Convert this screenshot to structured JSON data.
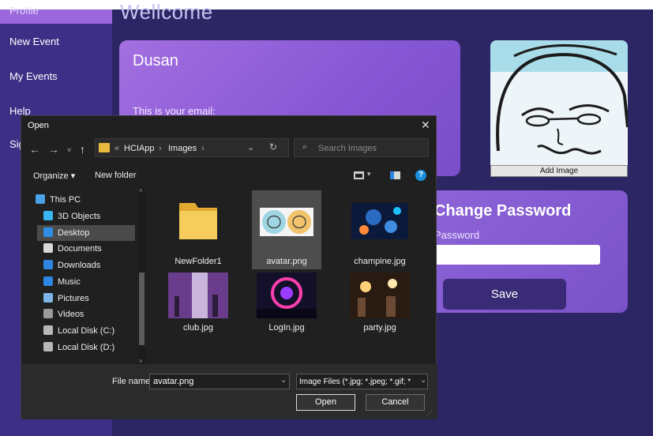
{
  "sidebar": {
    "items": [
      {
        "label": "Profile"
      },
      {
        "label": "New Event"
      },
      {
        "label": "My Events"
      },
      {
        "label": "Help"
      },
      {
        "label": "Sign Out"
      }
    ]
  },
  "main": {
    "welcome": "Wellcome",
    "user_card": {
      "name": "Dusan",
      "email_label": "This is your email:"
    },
    "avatar": {
      "add_image_label": "Add Image"
    },
    "password_card": {
      "title": "Change Password",
      "field_label": "Password",
      "save_label": "Save"
    }
  },
  "dialog": {
    "title": "Open",
    "breadcrumb": [
      "«",
      "HCIApp",
      "›",
      "Images",
      "›"
    ],
    "search_placeholder": "Search Images",
    "toolbar": {
      "organize": "Organize ▾",
      "new_folder": "New folder",
      "help": "?"
    },
    "nav_items": [
      {
        "label": "This PC",
        "icon": "pc-icon",
        "color": "#4aa3e8"
      },
      {
        "label": "3D Objects",
        "icon": "cube-icon",
        "color": "#39b6f0"
      },
      {
        "label": "Desktop",
        "icon": "desktop-icon",
        "color": "#2e8ee6"
      },
      {
        "label": "Documents",
        "icon": "document-icon",
        "color": "#d8d8d8"
      },
      {
        "label": "Downloads",
        "icon": "download-icon",
        "color": "#2f86e2"
      },
      {
        "label": "Music",
        "icon": "music-icon",
        "color": "#2f86e2"
      },
      {
        "label": "Pictures",
        "icon": "picture-icon",
        "color": "#7cb6e6"
      },
      {
        "label": "Videos",
        "icon": "video-icon",
        "color": "#9a9a9a"
      },
      {
        "label": "Local Disk (C:)",
        "icon": "disk-icon",
        "color": "#b8b8b8"
      },
      {
        "label": "Local Disk (D:)",
        "icon": "disk-icon",
        "color": "#b8b8b8"
      }
    ],
    "files": [
      {
        "name": "NewFolder1",
        "kind": "folder"
      },
      {
        "name": "avatar.png",
        "kind": "image",
        "selected": true
      },
      {
        "name": "champine.jpg",
        "kind": "image"
      },
      {
        "name": "club.jpg",
        "kind": "image"
      },
      {
        "name": "LogIn.jpg",
        "kind": "image"
      },
      {
        "name": "party.jpg",
        "kind": "image"
      }
    ],
    "file_name_label": "File name:",
    "file_name_value": "avatar.png",
    "file_type_value": "Image Files (*.jpg; *.jpeg; *.gif; *",
    "open_label": "Open",
    "cancel_label": "Cancel"
  }
}
